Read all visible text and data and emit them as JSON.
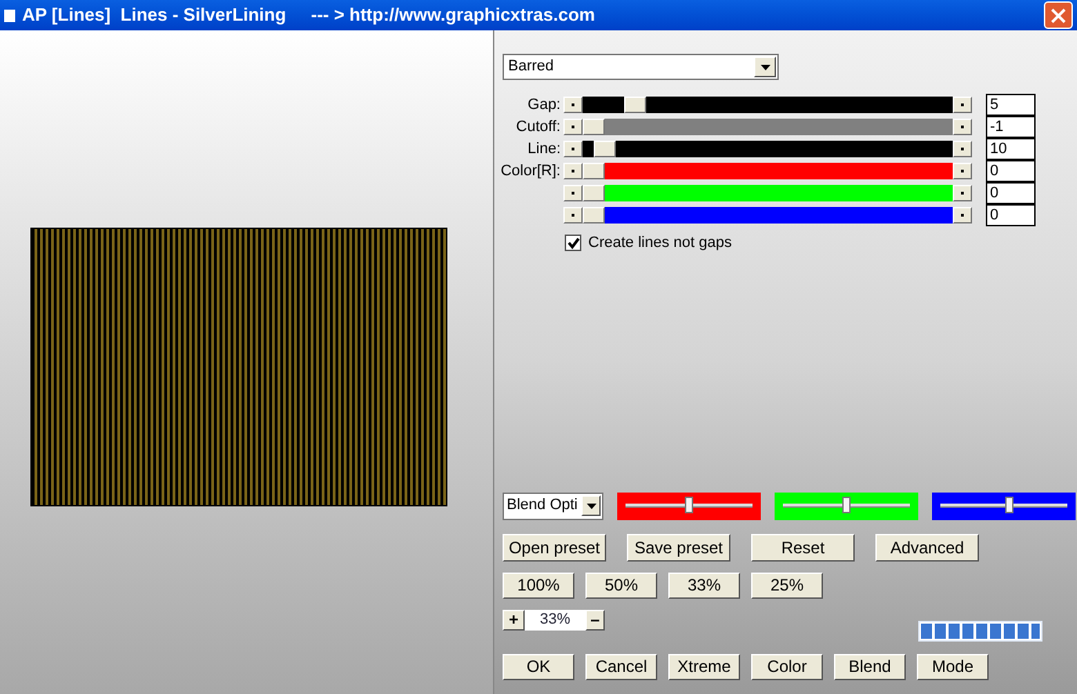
{
  "window": {
    "title": "AP [Lines]  Lines - SilverLining     --- > http://www.graphicxtras.com"
  },
  "preset_dropdown": {
    "value": "Barred"
  },
  "sliders": [
    {
      "label": "Gap:",
      "color": "#000000",
      "level": 0.12,
      "value": "5"
    },
    {
      "label": "Cutoff:",
      "color": "#808080",
      "level": 0.0,
      "value": "-1"
    },
    {
      "label": "Line:",
      "color": "#000000",
      "level": 0.03,
      "value": "10"
    },
    {
      "label": "Color[R]:",
      "color": "#ff0000",
      "level": 0.0,
      "value": "0"
    },
    {
      "color": "#00ff00",
      "level": 0.0,
      "value": "0"
    },
    {
      "color": "#0000ff",
      "level": 0.0,
      "value": "0"
    }
  ],
  "checkbox": {
    "label": "Create lines not gaps",
    "checked": true
  },
  "blend_dropdown": {
    "value": "Blend Opti"
  },
  "color_sliders": [
    {
      "color": "#ff0000",
      "level": 0.5
    },
    {
      "color": "#00ff00",
      "level": 0.5
    },
    {
      "color": "#0000ff",
      "level": 0.55
    }
  ],
  "preset_buttons": [
    "Open preset",
    "Save preset",
    "Reset",
    "Advanced"
  ],
  "zoom_buttons": [
    "100%",
    "50%",
    "33%",
    "25%"
  ],
  "zoom": {
    "plus": "+",
    "value": "33%",
    "minus": "–"
  },
  "progress": {
    "level": 1
  },
  "bottom_buttons": [
    "OK",
    "Cancel",
    "Xtreme",
    "Color",
    "Blend",
    "Mode"
  ]
}
